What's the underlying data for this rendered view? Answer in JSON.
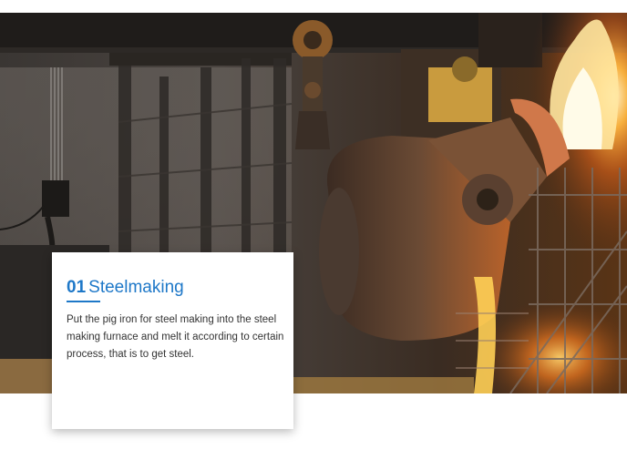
{
  "hero": {
    "image": "steel-furnace-photo"
  },
  "card": {
    "number": "01",
    "title": "Steelmaking",
    "description": "Put the pig iron for steel making into the steel making furnace and melt it according to certain process, that is to get steel.",
    "accent_color": "#1e78c8"
  }
}
